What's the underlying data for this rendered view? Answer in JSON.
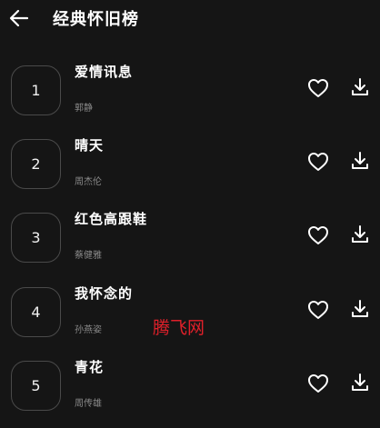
{
  "header": {
    "title": "经典怀旧榜",
    "back_icon": "arrow-left-icon"
  },
  "songs": [
    {
      "rank": "1",
      "title": "爱情讯息",
      "artist": "郭静"
    },
    {
      "rank": "2",
      "title": "晴天",
      "artist": "周杰伦"
    },
    {
      "rank": "3",
      "title": "红色高跟鞋",
      "artist": "蔡健雅"
    },
    {
      "rank": "4",
      "title": "我怀念的",
      "artist": "孙燕姿"
    },
    {
      "rank": "5",
      "title": "青花",
      "artist": "周传雄"
    }
  ],
  "icons": {
    "favorite": "heart-outline-icon",
    "download": "download-icon"
  },
  "watermark": "腾飞网",
  "colors": {
    "background": "#151515",
    "text": "#ffffff",
    "subtext": "#8a8a8a",
    "watermark": "#e0202a"
  }
}
